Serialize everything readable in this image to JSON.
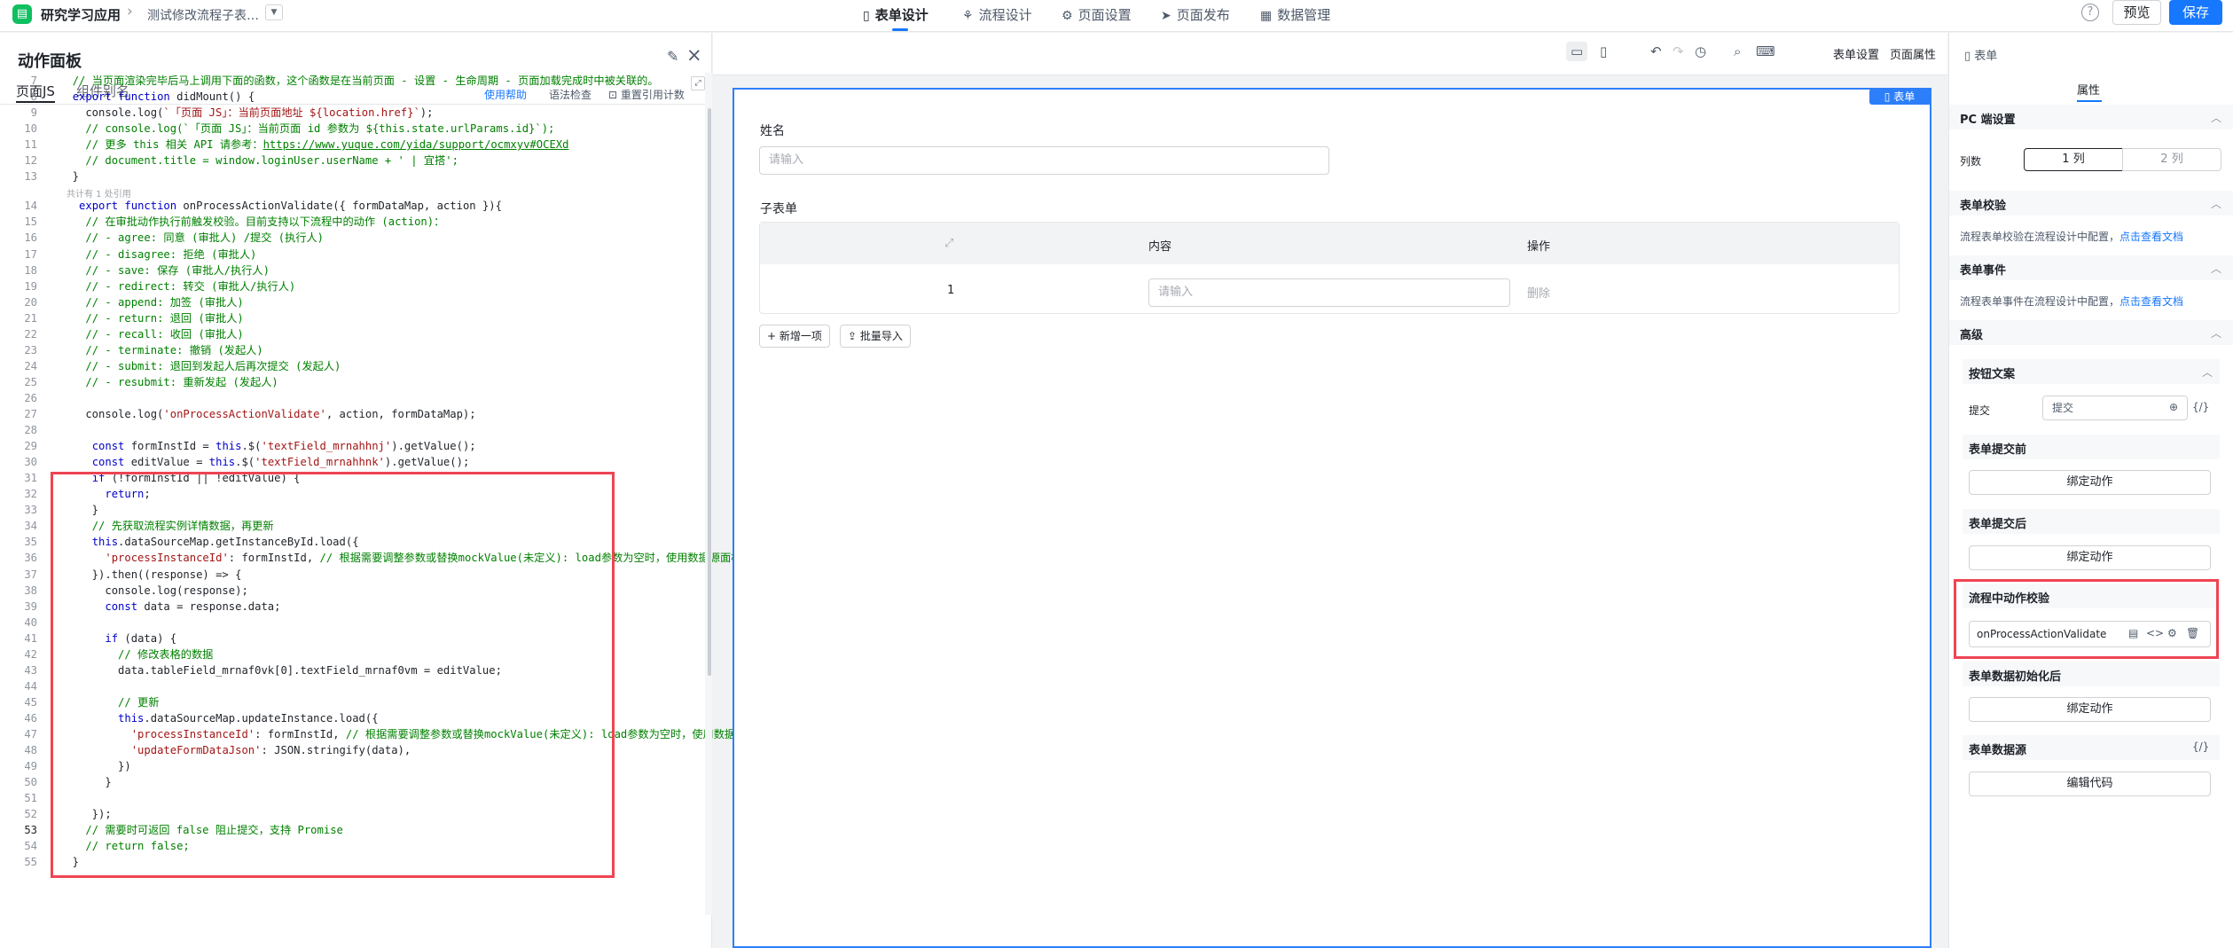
{
  "topbar": {
    "app_name": "研究学习应用",
    "form_name": "测试修改流程子表…",
    "nav": [
      {
        "label": "表单设计",
        "icon": "document-icon"
      },
      {
        "label": "流程设计",
        "icon": "flow-icon"
      },
      {
        "label": "页面设置",
        "icon": "gear-icon"
      },
      {
        "label": "页面发布",
        "icon": "send-icon"
      },
      {
        "label": "数据管理",
        "icon": "grid-icon"
      }
    ],
    "preview_label": "预览",
    "save_label": "保存"
  },
  "action_panel": {
    "title": "动作面板",
    "tabs": [
      "页面JS",
      "组件别名"
    ],
    "links": [
      "使用帮助",
      "语法检查",
      "重置引用计数"
    ],
    "ref_hint": "共计有 1 处引用",
    "lines": [
      {
        "n": "7",
        "t": "  // 当页面渲染完毕后马上调用下面的函数，这个函数是在当前页面 - 设置 - 生命周期 - 页面加载完成时中被关联的。"
      },
      {
        "n": "8",
        "t": "  export function didMount() {"
      },
      {
        "n": "9",
        "t": "    console.log(`「页面 JS」：当前页面地址 ${location.href}`);"
      },
      {
        "n": "10",
        "t": "    // console.log(`「页面 JS」：当前页面 id 参数为 ${this.state.urlParams.id}`);"
      },
      {
        "n": "11",
        "t": "    // 更多 this 相关 API 请参考：https://www.yuque.com/yida/support/ocmxyv#OCEXd"
      },
      {
        "n": "12",
        "t": "    // document.title = window.loginUser.userName + ' | 宜搭';"
      },
      {
        "n": "13",
        "t": "  }"
      },
      {
        "n": "14",
        "t": "   export function onProcessActionValidate({ formDataMap, action }){"
      },
      {
        "n": "15",
        "t": "    // 在审批动作执行前触发校验。目前支持以下流程中的动作 (action)："
      },
      {
        "n": "16",
        "t": "    // - agree: 同意 (审批人) /提交 (执行人)"
      },
      {
        "n": "17",
        "t": "    // - disagree: 拒绝 (审批人)"
      },
      {
        "n": "18",
        "t": "    // - save: 保存 (审批人/执行人)"
      },
      {
        "n": "19",
        "t": "    // - redirect: 转交 (审批人/执行人)"
      },
      {
        "n": "20",
        "t": "    // - append: 加签 (审批人)"
      },
      {
        "n": "21",
        "t": "    // - return: 退回 (审批人)"
      },
      {
        "n": "22",
        "t": "    // - recall: 收回 (审批人)"
      },
      {
        "n": "23",
        "t": "    // - terminate: 撤销 (发起人)"
      },
      {
        "n": "24",
        "t": "    // - submit: 退回到发起人后再次提交 (发起人)"
      },
      {
        "n": "25",
        "t": "    // - resubmit: 重新发起 (发起人)"
      },
      {
        "n": "26",
        "t": ""
      },
      {
        "n": "27",
        "t": "    console.log('onProcessActionValidate', action, formDataMap);"
      },
      {
        "n": "28",
        "t": ""
      },
      {
        "n": "29",
        "t": "     const formInstId = this.$('textField_mrnahhnj').getValue();"
      },
      {
        "n": "30",
        "t": "     const editValue = this.$('textField_mrnahhnk').getValue();"
      },
      {
        "n": "31",
        "t": "     if (!formInstId || !editValue) {"
      },
      {
        "n": "32",
        "t": "       return;"
      },
      {
        "n": "33",
        "t": "     }"
      },
      {
        "n": "34",
        "t": "     // 先获取流程实例详情数据，再更新"
      },
      {
        "n": "35",
        "t": "     this.dataSourceMap.getInstanceById.load({"
      },
      {
        "n": "36",
        "t": "       'processInstanceId': formInstId, // 根据需要调整参数或替换mockValue(未定义): load参数为空时，使用数据源面板"
      },
      {
        "n": "37",
        "t": "     }).then((response) => {"
      },
      {
        "n": "38",
        "t": "       console.log(response);"
      },
      {
        "n": "39",
        "t": "       const data = response.data;"
      },
      {
        "n": "40",
        "t": ""
      },
      {
        "n": "41",
        "t": "       if (data) {"
      },
      {
        "n": "42",
        "t": "         // 修改表格的数据"
      },
      {
        "n": "43",
        "t": "         data.tableField_mrnaf0vk[0].textField_mrnaf0vm = editValue;"
      },
      {
        "n": "44",
        "t": ""
      },
      {
        "n": "45",
        "t": "         // 更新"
      },
      {
        "n": "46",
        "t": "         this.dataSourceMap.updateInstance.load({"
      },
      {
        "n": "47",
        "t": "           'processInstanceId': formInstId, // 根据需要调整参数或替换mockValue(未定义): load参数为空时，使用数据源"
      },
      {
        "n": "48",
        "t": "           'updateFormDataJson': JSON.stringify(data),"
      },
      {
        "n": "49",
        "t": "         })"
      },
      {
        "n": "50",
        "t": "       }"
      },
      {
        "n": "51",
        "t": ""
      },
      {
        "n": "52",
        "t": "     });"
      },
      {
        "n": "53",
        "t": "    // 需要时可返回 false 阻止提交，支持 Promise"
      },
      {
        "n": "54",
        "t": "    // return false;"
      },
      {
        "n": "55",
        "t": "  }"
      }
    ]
  },
  "canvas_toolbar": {
    "form_settings": "表单设置",
    "page_props": "页面属性"
  },
  "form": {
    "badge": "表单",
    "name_label": "姓名",
    "name_placeholder": "请输入",
    "subform_label": "子表单",
    "col_content": "内容",
    "col_action": "操作",
    "row_index": "1",
    "row_placeholder": "请输入",
    "row_delete": "删除",
    "add_btn": "新增一项",
    "import_btn": "批量导入"
  },
  "right_panel": {
    "header": "表单",
    "tab": "属性",
    "pc_settings": "PC 端设置",
    "columns_label": "列数",
    "col_1": "1 列",
    "col_2": "2 列",
    "validate_title": "表单校验",
    "validate_text": "流程表单校验在流程设计中配置，",
    "doc_link": "点击查看文档",
    "events_title": "表单事件",
    "events_text": "流程表单事件在流程设计中配置，",
    "doc_link2": "点击查看文档",
    "advanced_title": "高级",
    "btn_text_title": "按钮文案",
    "submit_label": "提交",
    "submit_value": "提交",
    "before_submit": "表单提交前",
    "bind_action_1": "绑定动作",
    "after_submit": "表单提交后",
    "bind_action_2": "绑定动作",
    "process_validate": "流程中动作校验",
    "process_validate_value": "onProcessActionValidate",
    "data_init": "表单数据初始化后",
    "bind_action_3": "绑定动作",
    "data_source": "表单数据源",
    "edit_code": "编辑代码"
  }
}
